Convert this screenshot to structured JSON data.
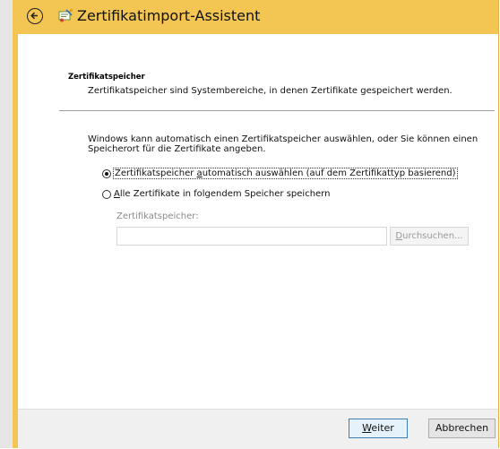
{
  "window": {
    "title": "Zertifikatimport-Assistent",
    "accent_color": "#f3c552"
  },
  "section": {
    "heading": "Zertifikatspeicher",
    "subheading": "Zertifikatspeicher sind Systembereiche, in denen Zertifikate gespeichert werden."
  },
  "body": {
    "description": "Windows kann automatisch einen Zertifikatspeicher auswählen, oder Sie können einen Speicherort für die Zertifikate angeben."
  },
  "options": [
    {
      "label_pre": "Zertifikatspeicher ",
      "label_accel": "a",
      "label_post": "utomatisch auswählen (auf dem Zertifikattyp basierend)",
      "checked": true
    },
    {
      "label_pre": "",
      "label_accel": "A",
      "label_post": "lle Zertifikate in folgendem Speicher speichern",
      "checked": false
    }
  ],
  "store": {
    "label": "Zertifikatspeicher:",
    "value": "",
    "browse_accel": "D",
    "browse_rest": "urchsuchen..."
  },
  "footer": {
    "next_accel": "W",
    "next_rest": "eiter",
    "cancel_label": "Abbrechen"
  }
}
